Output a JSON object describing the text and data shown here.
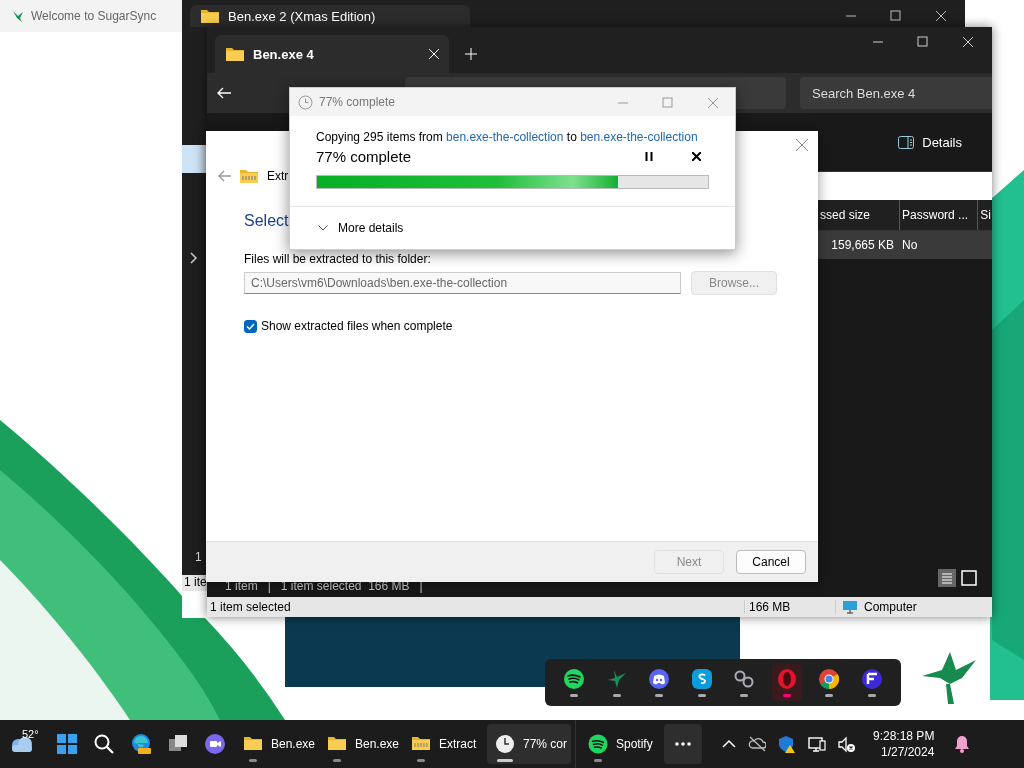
{
  "desktop_app": {
    "title": "Welcome to SugarSync"
  },
  "back_window": {
    "tab": "Ben.exe 2 (Xmas Edition)",
    "list_text": "1",
    "status_text": "1 ite"
  },
  "explorer": {
    "tab": "Ben.exe 4",
    "search": {
      "placeholder": "Search Ben.exe 4"
    },
    "toolbar": [
      "Details"
    ],
    "columns": [
      "ssed size",
      "Password ...",
      "Si"
    ],
    "rows": [
      {
        "cells": [
          "159,665 KB",
          "No"
        ],
        "selected": true
      }
    ],
    "status_text": "1 item   |   1 item selected  166 MB   |",
    "status_bar": {
      "selection": "1 item selected",
      "size": "166 MB",
      "zone": "Computer"
    }
  },
  "extract_dialog": {
    "title": "Extr",
    "heading": "Select",
    "folder_label": "Files will be extracted to this folder:",
    "folder_path": "C:\\Users\\vm6\\Downloads\\ben.exe-the-collection",
    "browse_button": {
      "label": "Browse...",
      "disabled": true
    },
    "show_files": {
      "label": "Show extracted files when complete",
      "checked": true
    },
    "buttons": [
      {
        "label": "Next",
        "disabled": true
      },
      {
        "label": "Cancel",
        "disabled": false
      }
    ]
  },
  "progress_dialog": {
    "title": "77% complete",
    "message": [
      {
        "kind": "text",
        "text": "Copying 295 items from "
      },
      {
        "kind": "link",
        "text": "ben.exe-the-collection"
      },
      {
        "kind": "text",
        "text": " to "
      },
      {
        "kind": "link",
        "text": "ben.exe-the-collection"
      }
    ],
    "status": "77% complete",
    "level": 0.77,
    "details_toggle": {
      "label": "More details",
      "expanded": false
    }
  },
  "taskbar": {
    "weather": "52°",
    "apps": [
      {
        "label": "Ben.exe",
        "kind": "folder",
        "selected": false
      },
      {
        "label": "Ben.exe",
        "kind": "folder",
        "selected": false
      },
      {
        "label": "Extract",
        "kind": "zip",
        "selected": false
      },
      {
        "label": "77% cor",
        "kind": "clock",
        "selected": true
      },
      {
        "label": "Spotify",
        "kind": "spotify",
        "selected": false
      }
    ],
    "time": "9:28:18 PM",
    "date": "1/27/2024"
  }
}
